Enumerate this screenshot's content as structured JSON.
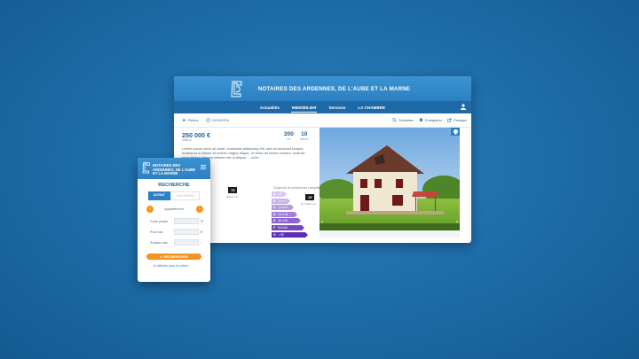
{
  "site": {
    "title": "NOTAIRES DES ARDENNES, DE L'AUBE ET LA MARNE"
  },
  "nav": {
    "items": [
      "Actualités",
      "IMMOBILIER",
      "Services",
      "LA CHAMBRE"
    ],
    "active": "IMMOBILIER"
  },
  "toolbar": {
    "back": "Retour",
    "date": "10/10/2014",
    "similar": "Similaires",
    "save": "Enregistrer",
    "share": "Partager"
  },
  "listing": {
    "price": "250 000 €",
    "price_sub": "Maison",
    "surface_value": "200",
    "surface_unit": "m²",
    "rooms_value": "10",
    "rooms_unit": "pièces",
    "description": "Lorem ipsum dolor sit amet, consectat adipiscing elit, sed do eiusmod tempor incididunt ut labore et dolore magna aliqua. Ut enim ad minim veniam, nostrud exercitation ullamco laboris nisi ut aliquip",
    "more": "... suite",
    "energy_heading": "Diagnostic de performance énergétique",
    "energy_value": "75",
    "energy_unit": "kWh/m².an",
    "ges_value": "15",
    "ges_unit": "kg CO2/m².an",
    "energy_classes": [
      {
        "letter": "A",
        "range": "≤ 5",
        "color": "#d6c8f2"
      },
      {
        "letter": "B",
        "range": "6 à 10",
        "color": "#c4b1ec"
      },
      {
        "letter": "C",
        "range": "11 à 20",
        "color": "#b498e6"
      },
      {
        "letter": "D",
        "range": "21 à 35",
        "color": "#a17fdc"
      },
      {
        "letter": "E",
        "range": "36 à 55",
        "color": "#8b64d0"
      },
      {
        "letter": "F",
        "range": "56 à 80",
        "color": "#7548c2"
      },
      {
        "letter": "G",
        "range": "> 80",
        "color": "#5e2fb1"
      }
    ]
  },
  "mobile": {
    "title": "NOTAIRES DES ARDENNES, DE L'AUBE ET LA MARNE",
    "heading": "RECHERCHE",
    "tab_buy": "ACHAT",
    "tab_rent": "LOCATION",
    "type": "Appartement",
    "fields": [
      {
        "label": "Code postal",
        "icon": "location-icon"
      },
      {
        "label": "Prix max.",
        "icon": "euro-icon"
      },
      {
        "label": "Surface min.",
        "icon": "area-icon"
      }
    ],
    "search_button": "RECHERCHER",
    "more_criteria": "Afficher plus de critère"
  },
  "colors": {
    "brand_blue": "#2c80c2",
    "nav_blue": "#1f6aa6",
    "accent_orange": "#f39420"
  }
}
